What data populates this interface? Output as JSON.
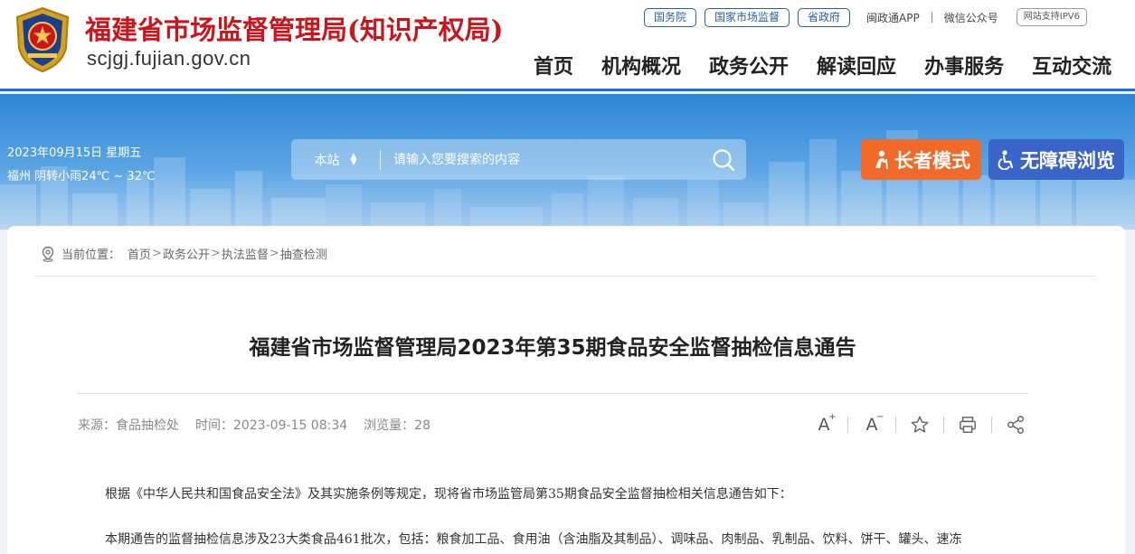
{
  "header": {
    "site_title": "福建省市场监督管理局(知识产权局)",
    "domain": "scjgj.fujian.gov.cn",
    "top_links": {
      "guowuyuan": "国务院",
      "guojia": "国家市场监督",
      "shengzhengfu": "省政府",
      "app": "闽政通APP",
      "wechat": "微信公众号",
      "ipv6": "网站支持IPV6"
    },
    "nav": [
      "首页",
      "机构概况",
      "政务公开",
      "解读回应",
      "办事服务",
      "互动交流"
    ]
  },
  "banner": {
    "date": "2023年09月15日 星期五",
    "weather": "福州 阴转小雨24℃ ~ 32℃",
    "search_scope": "本站",
    "search_placeholder": "请输入您要搜索的内容",
    "elder_mode": "长者模式",
    "accessible": "无障碍浏览"
  },
  "breadcrumb": {
    "label": "当前位置：",
    "items": [
      "首页",
      "政务公开",
      "执法监督",
      "抽查检测"
    ]
  },
  "article": {
    "title": "福建省市场监督管理局2023年第35期食品安全监督抽检信息通告",
    "source": "来源：食品抽检处",
    "time": "时间：2023-09-15 08:34",
    "views": "浏览量：28",
    "paragraphs": [
      "根据《中华人民共和国食品安全法》及其实施条例等规定，现将省市场监管局第35期食品安全监督抽检相关信息通告如下：",
      "本期通告的监督抽检信息涉及23大类食品461批次，包括：粮食加工品、食用油（含油脂及其制品）、调味品、肉制品、乳制品、饮料、饼干、罐头、速冻"
    ]
  },
  "tools": {
    "font_larger": "A",
    "font_smaller": "A",
    "plus": "+",
    "minus": "−"
  },
  "colors": {
    "title_red": "#c8161d",
    "nav_blue": "#1e6fd0",
    "elder_orange": "#f06b2a",
    "access_blue": "#3b64c8"
  }
}
